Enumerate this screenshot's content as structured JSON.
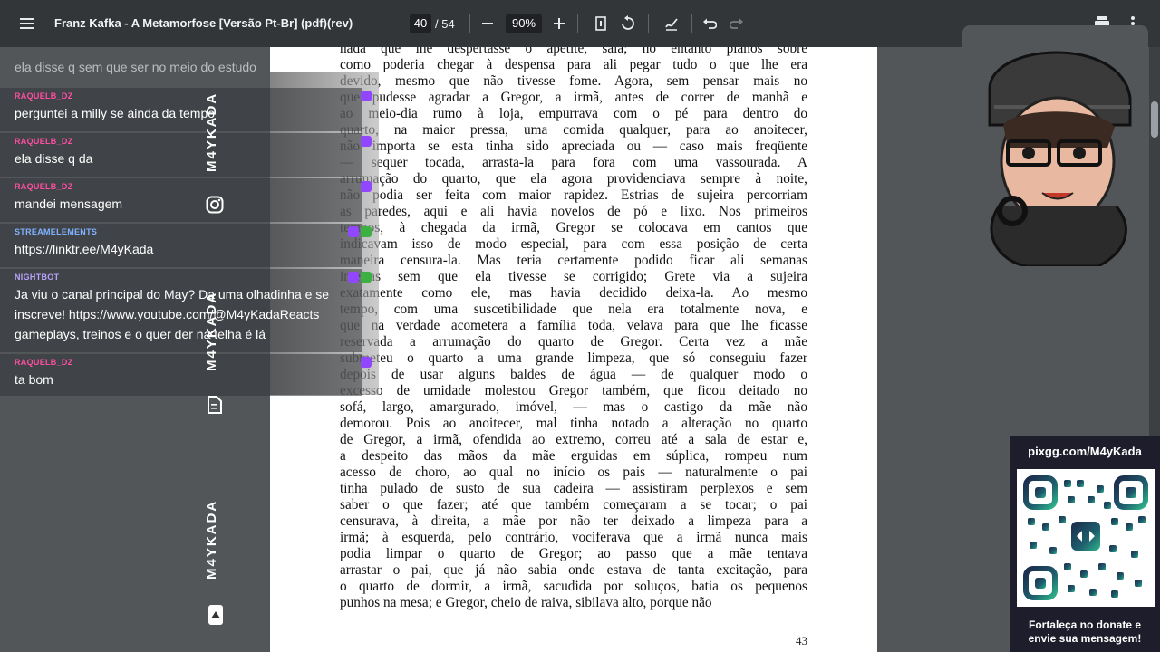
{
  "toolbar": {
    "title": "Franz Kafka - A Metamorfose [Versão Pt-Br] (pdf)(rev)",
    "current_page": "40",
    "total_pages": "/ 54",
    "zoom": "90%"
  },
  "pdf": {
    "paragraph_lines": [
      "nada que lhe despertasse o apetite, saía; no entanto planos sobre",
      "como poderia chegar à despensa para ali pegar tudo o que lhe era",
      "devido, mesmo que não tivesse fome. Agora, sem pensar mais no",
      "que pudesse agradar a Gregor, a irmã, antes de correr de manhã e",
      "ao meio-dia rumo à loja, empurrava com o pé para dentro do",
      "quarto, na maior pressa, uma comida qualquer, para ao anoitecer,",
      "não importa se esta tinha sido apreciada ou — caso mais freqüente",
      "— sequer tocada, arrasta-la para fora com uma vassourada. A",
      "arrumação do quarto, que ela agora providenciava sempre à noite,",
      "não podia ser feita com maior rapidez. Estrias de sujeira percorriam",
      "as paredes, aqui e ali havia novelos de pó e lixo. Nos primeiros",
      "tempos, à chegada da irmã, Gregor se colocava em cantos que",
      "indicavam isso de modo especial, para com essa posição de certa",
      "maneira censura-la. Mas teria certamente podido ficar ali semanas",
      "inteiras sem que ela tivesse se corrigido; Grete via a sujeira",
      "exatamente como ele, mas havia decidido deixa-la. Ao mesmo",
      "tempo, com uma suscetibilidade que nela era totalmente nova, e",
      "que na verdade acometera a família toda, velava para que lhe ficasse",
      "reservada a arrumação do quarto de Gregor. Certa vez a mãe",
      "submeteu o quarto a uma grande limpeza, que só conseguiu fazer",
      "depois de usar alguns baldes de água — de qualquer modo o",
      "excesso de umidade molestou Gregor também, que ficou deitado no",
      "sofá, largo, amargurado, imóvel, — mas o castigo da mãe não",
      "demorou. Pois ao anoitecer, mal tinha notado a alteração no quarto",
      "de Gregor, a irmã, ofendida ao extremo, correu até a sala de estar e,",
      "a despeito das mãos da mãe erguidas em súplica, rompeu num",
      "acesso de choro, ao qual no início os pais — naturalmente o pai",
      "tinha pulado de susto de sua cadeira — assistiram perplexos e sem",
      "saber o que fazer; até que também começaram a se tocar; o pai",
      "censurava, à direita, a mãe por não ter deixado a limpeza para a",
      "irmã; à esquerda, pelo contrário, vociferava que a irmã nunca mais",
      "podia limpar o quarto de Gregor; ao passo que a mãe tentava",
      "arrastar o pai, que já não sabia onde estava de tanta excitação, para",
      "o quarto de dormir, a irmã, sacudida por soluços, batia os pequenos",
      "punhos na mesa; e Gregor, cheio de raiva, sibilava alto, porque não"
    ],
    "page_number": "43"
  },
  "chat": {
    "top_cut_text": "ela disse q sem que ser no meio do estudo",
    "messages": [
      {
        "user": "RAQUELB_DZ",
        "text": "perguntei a milly se ainda da tempo"
      },
      {
        "user": "RAQUELB_DZ",
        "text": "ela disse q da"
      },
      {
        "user": "RAQUELB_DZ",
        "text": "mandei mensagem"
      },
      {
        "user": "STREAMELEMENTS",
        "text": "https://linktr.ee/M4yKada"
      },
      {
        "user": "NIGHTBOT",
        "text": "Ja viu o canal principal do May? Da uma olhadinha e se inscreve! https://www.youtube.com/@M4yKadaReacts gameplays, treinos e o quer der na telha é lá"
      },
      {
        "user": "RAQUELB_DZ",
        "text": "ta bom"
      }
    ]
  },
  "overlay": {
    "watermark": "M4YKADA",
    "qr_title": "pixgg.com/M4yKada",
    "qr_caption_line1": "Fortaleça no donate e",
    "qr_caption_line2": "envie sua mensagem!"
  },
  "colors": {
    "toolbar_bg": "#323639",
    "viewer_bg": "#525659",
    "raquel_user": "#ff4fa3",
    "streamelements_user": "#7fb3ff",
    "nightbot_user": "#b9a4ff"
  },
  "icons": [
    "menu-icon",
    "zoom-out-icon",
    "zoom-in-icon",
    "fit-page-icon",
    "rotate-icon",
    "annotate-icon",
    "undo-icon",
    "redo-icon",
    "print-icon",
    "more-vert-icon",
    "instagram-icon",
    "document-icon",
    "up-arrow-icon"
  ]
}
